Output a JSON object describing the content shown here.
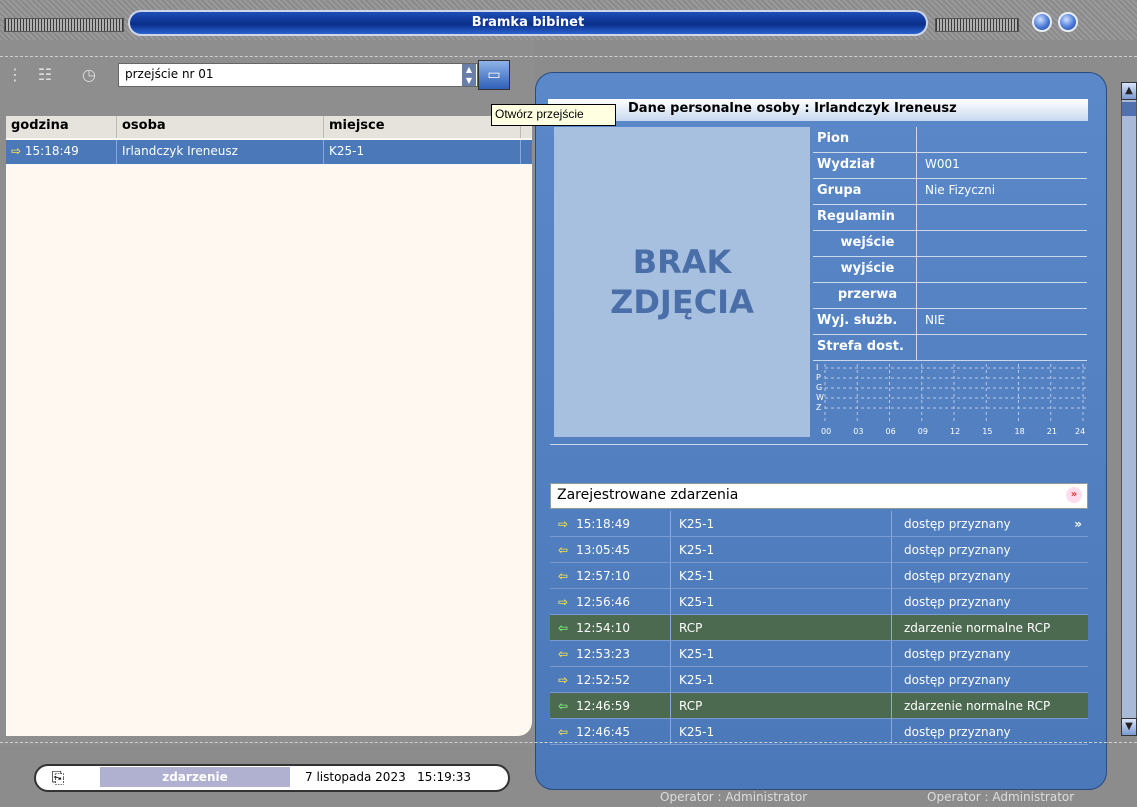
{
  "window": {
    "title": "Bramka bibinet"
  },
  "toolbar": {
    "passage_value": "przejście nr 01",
    "tooltip": "Otwórz przejście"
  },
  "list": {
    "headers": [
      "godzina",
      "osoba",
      "miejsce"
    ],
    "rows": [
      {
        "time": "15:18:49",
        "person": "Irlandczyk Ireneusz",
        "place": "K25-1"
      }
    ]
  },
  "person": {
    "header": "Dane personalne osoby : Irlandczyk Ireneusz",
    "photo_placeholder_line1": "BRAK",
    "photo_placeholder_line2": "ZDJĘCIA",
    "fields": [
      {
        "label": "Pion",
        "value": ""
      },
      {
        "label": "Wydział",
        "value": "W001"
      },
      {
        "label": "Grupa",
        "value": "Nie Fizyczni"
      },
      {
        "label": "Regulamin",
        "value": ""
      },
      {
        "label": "wejście",
        "value": ""
      },
      {
        "label": "wyjście",
        "value": ""
      },
      {
        "label": "przerwa",
        "value": ""
      },
      {
        "label": "Wyj. służb.",
        "value": "NIE"
      },
      {
        "label": "Strefa dost.",
        "value": ""
      }
    ],
    "chart_letters": [
      "I",
      "P",
      "G",
      "W",
      "Z"
    ],
    "chart_hours": [
      "00",
      "03",
      "06",
      "09",
      "12",
      "15",
      "18",
      "21",
      "24"
    ]
  },
  "events": {
    "title": "Zarejestrowane zdarzenia",
    "rows": [
      {
        "dir": "in",
        "time": "15:18:49",
        "place": "K25-1",
        "status": "dostęp przyznany",
        "rcp": false
      },
      {
        "dir": "out",
        "time": "13:05:45",
        "place": "K25-1",
        "status": "dostęp przyznany",
        "rcp": false
      },
      {
        "dir": "out",
        "time": "12:57:10",
        "place": "K25-1",
        "status": "dostęp przyznany",
        "rcp": false
      },
      {
        "dir": "in",
        "time": "12:56:46",
        "place": "K25-1",
        "status": "dostęp przyznany",
        "rcp": false
      },
      {
        "dir": "out",
        "time": "12:54:10",
        "place": "RCP",
        "status": "zdarzenie normalne RCP",
        "rcp": true
      },
      {
        "dir": "out",
        "time": "12:53:23",
        "place": "K25-1",
        "status": "dostęp przyznany",
        "rcp": false
      },
      {
        "dir": "in",
        "time": "12:52:52",
        "place": "K25-1",
        "status": "dostęp przyznany",
        "rcp": false
      },
      {
        "dir": "out",
        "time": "12:46:59",
        "place": "RCP",
        "status": "zdarzenie normalne RCP",
        "rcp": true
      },
      {
        "dir": "out",
        "time": "12:46:45",
        "place": "K25-1",
        "status": "dostęp przyznany",
        "rcp": false
      }
    ],
    "more_glyph": "»"
  },
  "statusbar": {
    "event_label": "zdarzenie",
    "date": "7 listopada 2023",
    "time": "15:19:33"
  },
  "footer": {
    "operator_left": "Operator : Administrator",
    "operator_right": "Operator : Administrator"
  },
  "colors": {
    "accent": "#4a78b8",
    "rcp_row": "#4c6a50",
    "arrow_in": "#f5e04a",
    "arrow_rcp": "#7cf07c"
  }
}
